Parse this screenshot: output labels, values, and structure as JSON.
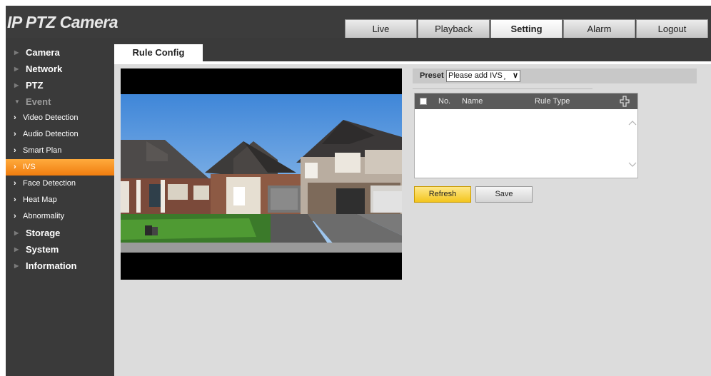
{
  "app": {
    "title": "IP PTZ Camera"
  },
  "top_tabs": [
    {
      "label": "Live",
      "active": false
    },
    {
      "label": "Playback",
      "active": false
    },
    {
      "label": "Setting",
      "active": true
    },
    {
      "label": "Alarm",
      "active": false
    },
    {
      "label": "Logout",
      "active": false
    }
  ],
  "sidebar": {
    "items": [
      {
        "label": "Camera"
      },
      {
        "label": "Network"
      },
      {
        "label": "PTZ"
      },
      {
        "label": "Event",
        "expanded": true
      },
      {
        "label": "Video Detection"
      },
      {
        "label": "Audio Detection"
      },
      {
        "label": "Smart Plan"
      },
      {
        "label": "IVS",
        "active": true
      },
      {
        "label": "Face Detection"
      },
      {
        "label": "Heat Map"
      },
      {
        "label": "Abnormality"
      },
      {
        "label": "Storage"
      },
      {
        "label": "System"
      },
      {
        "label": "Information"
      }
    ]
  },
  "content": {
    "tab_label": "Rule Config"
  },
  "preset": {
    "label": "Preset",
    "value": "Please add IVS ̧"
  },
  "rule_table": {
    "columns": [
      "No.",
      "Name",
      "Rule Type"
    ],
    "rows": []
  },
  "buttons": {
    "refresh": "Refresh",
    "save": "Save"
  },
  "icons": {
    "collapsed": "triangle-right-icon",
    "expanded": "triangle-down-icon",
    "submenu": "chevron-right-icon",
    "add": "add-rule-icon",
    "dropdown": "chevron-down-icon"
  },
  "colors": {
    "header_bg": "#3c3c3c",
    "sidebar_bg": "#3a3a3a",
    "active_orange": "#f58a1f",
    "refresh_yellow": "#f3c51e",
    "content_bg": "#dcdcdc"
  }
}
